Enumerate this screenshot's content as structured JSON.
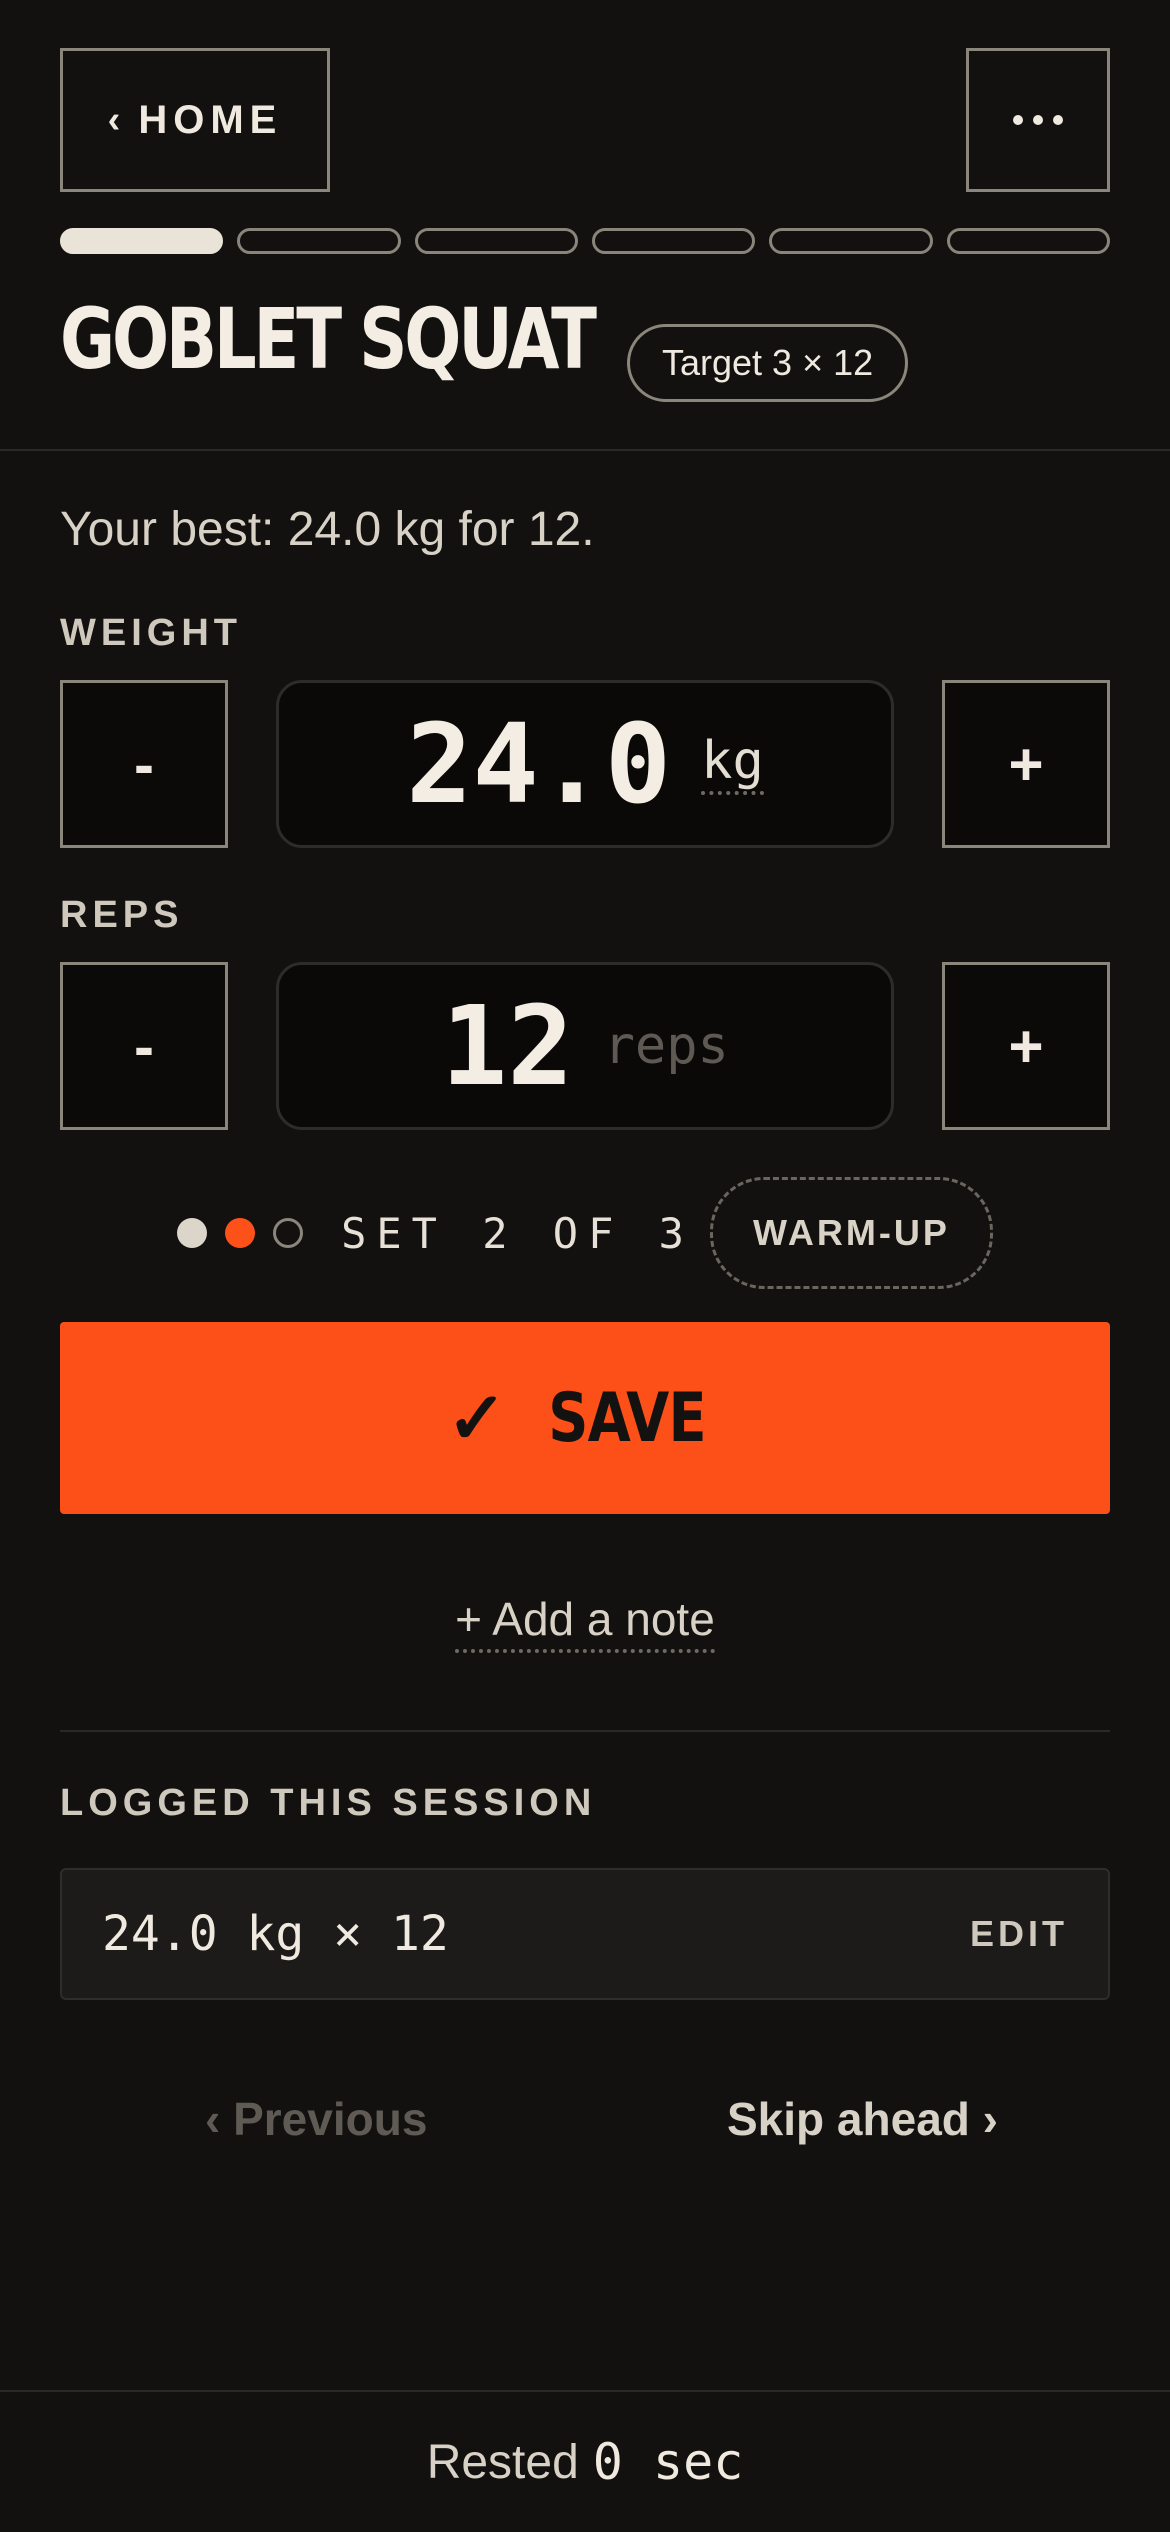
{
  "header": {
    "home_label": "HOME",
    "home_chevron": "‹",
    "more_icon": "more-dots-icon"
  },
  "progress": {
    "total_segments": 6,
    "completed_segments": 1
  },
  "exercise": {
    "title": "GOBLET SQUAT",
    "target": "Target 3 × 12",
    "best": "Your best: 24.0 kg for 12."
  },
  "weight": {
    "label": "WEIGHT",
    "value": "24.0",
    "unit": "kg",
    "minus": "-",
    "plus": "+"
  },
  "reps": {
    "label": "REPS",
    "value": "12",
    "unit": "reps",
    "minus": "-",
    "plus": "+"
  },
  "set": {
    "text": "SET 2 OF 3",
    "current": 2,
    "total": 3,
    "warmup_label": "WARM-UP"
  },
  "save": {
    "icon": "✓",
    "label": "SAVE"
  },
  "note": {
    "label": "+ Add a note"
  },
  "logged": {
    "heading": "LOGGED THIS SESSION",
    "entries": [
      {
        "value": "24.0 kg × 12",
        "edit_label": "EDIT"
      }
    ]
  },
  "nav": {
    "previous": "‹ Previous",
    "skip": "Skip ahead ›"
  },
  "rest": {
    "label": "Rested",
    "value": "0 sec"
  },
  "colors": {
    "accent": "#fd5019",
    "background": "#121110",
    "text": "#ece6dc"
  }
}
